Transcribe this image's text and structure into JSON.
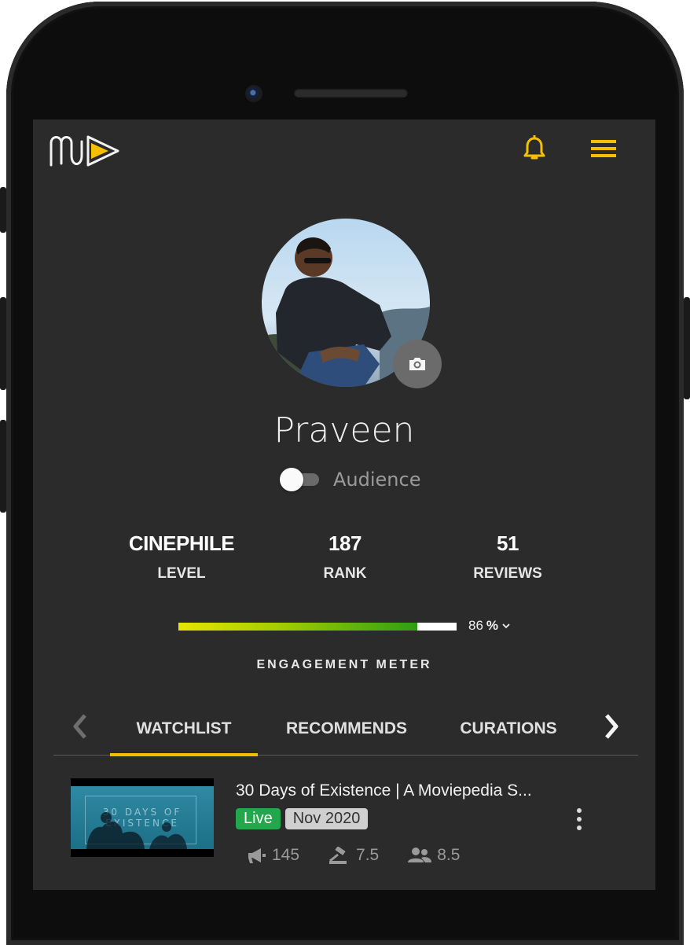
{
  "header": {
    "logo_name": "moviepedia-logo",
    "accent": "#f5c000"
  },
  "profile": {
    "name": "Praveen",
    "toggle_label": "Audience",
    "toggle_on": false
  },
  "stats": [
    {
      "value": "CINEPHILE",
      "label": "LEVEL"
    },
    {
      "value": "187",
      "label": "RANK"
    },
    {
      "value": "51",
      "label": "REVIEWS"
    }
  ],
  "engagement": {
    "title": "ENGAGEMENT METER",
    "value": "86",
    "unit": "%",
    "percent": 86
  },
  "tabs": [
    {
      "label": "WATCHLIST",
      "active": true
    },
    {
      "label": "RECOMMENDS",
      "active": false
    },
    {
      "label": "CURATIONS",
      "active": false
    }
  ],
  "watchlist": [
    {
      "title": "30 Days of Existence | A Moviepedia S...",
      "thumb_text": "30 DAYS OF EXISTENCE",
      "status": "Live",
      "date": "Nov 2020",
      "promotions": "145",
      "rating": "7.5",
      "audience_score": "8.5"
    }
  ]
}
